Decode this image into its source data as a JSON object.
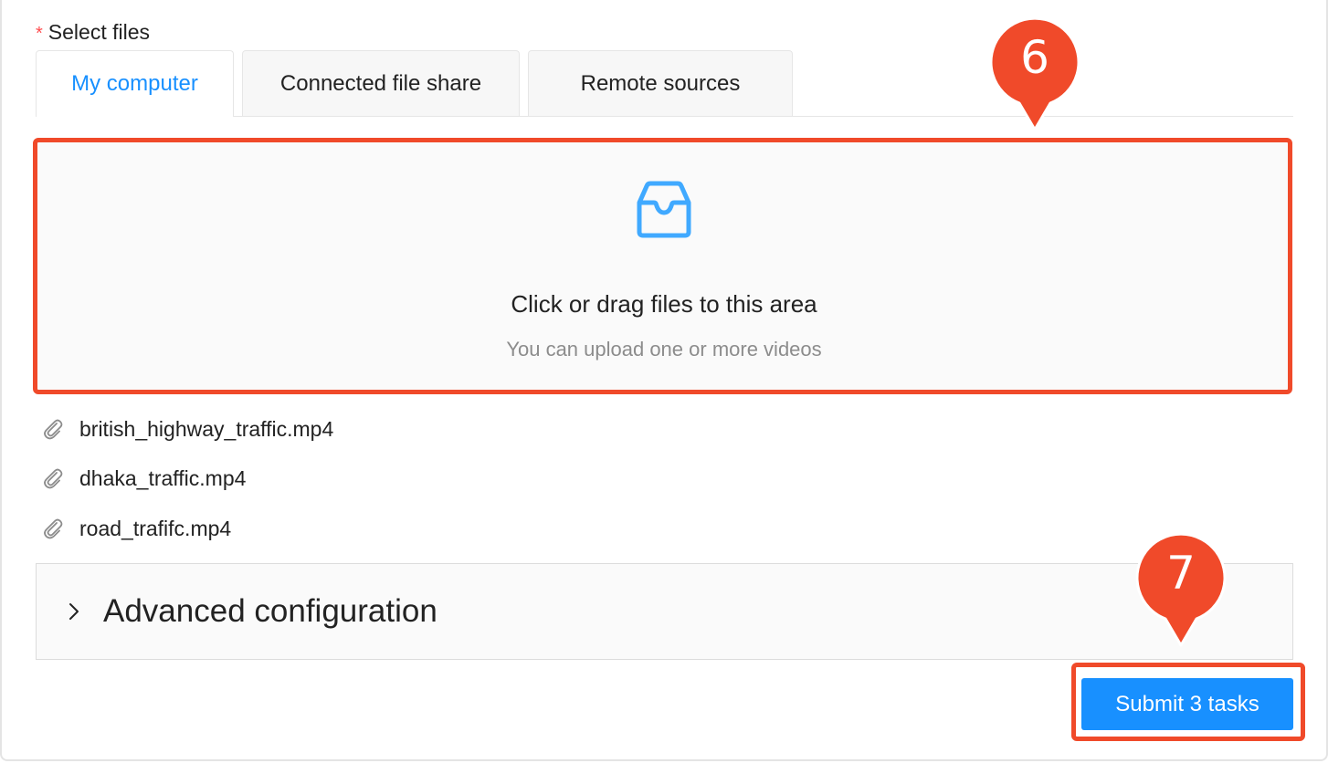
{
  "form": {
    "required_mark": "*",
    "label": "Select files"
  },
  "tabs": [
    {
      "label": "My computer",
      "active": true
    },
    {
      "label": "Connected file share",
      "active": false
    },
    {
      "label": "Remote sources",
      "active": false
    }
  ],
  "dropzone": {
    "icon": "inbox-icon",
    "title": "Click or drag files to this area",
    "hint": "You can upload one or more videos"
  },
  "files": [
    {
      "name": "british_highway_traffic.mp4",
      "icon": "paperclip-icon"
    },
    {
      "name": "dhaka_traffic.mp4",
      "icon": "paperclip-icon"
    },
    {
      "name": "road_trafifc.mp4",
      "icon": "paperclip-icon"
    }
  ],
  "advanced": {
    "title": "Advanced configuration",
    "icon": "chevron-right-icon"
  },
  "submit": {
    "label": "Submit 3 tasks"
  },
  "callouts": [
    {
      "number": "6"
    },
    {
      "number": "7"
    }
  ],
  "colors": {
    "accent": "#1890ff",
    "callout": "#f04a2a",
    "required": "#ff4d4f"
  }
}
